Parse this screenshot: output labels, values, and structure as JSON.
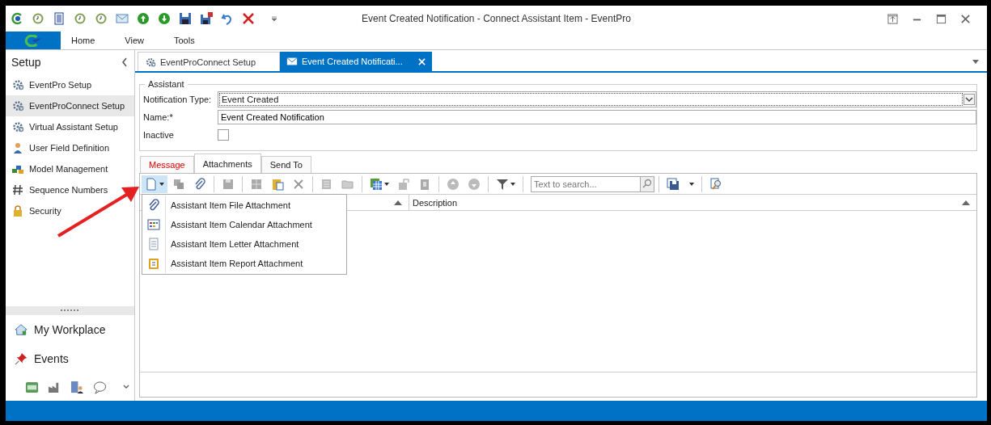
{
  "window": {
    "title": "Event Created Notification - Connect Assistant Item - EventPro"
  },
  "ribbon_tabs": [
    {
      "label": "Home"
    },
    {
      "label": "View"
    },
    {
      "label": "Tools"
    }
  ],
  "sidebar": {
    "title": "Setup",
    "items": [
      {
        "label": "EventPro Setup",
        "selected": false
      },
      {
        "label": "EventProConnect Setup",
        "selected": true
      },
      {
        "label": "Virtual Assistant Setup",
        "selected": false
      },
      {
        "label": "User Field Definition",
        "selected": false
      },
      {
        "label": "Model Management",
        "selected": false
      },
      {
        "label": "Sequence Numbers",
        "selected": false
      },
      {
        "label": "Security",
        "selected": false
      }
    ],
    "groups": [
      {
        "label": "My Workplace"
      },
      {
        "label": "Events"
      }
    ]
  },
  "doc_tabs": [
    {
      "label": "EventProConnect Setup",
      "selected": false
    },
    {
      "label": "Event Created Notificati...",
      "selected": true
    }
  ],
  "form": {
    "group": "Assistant",
    "notification_type": {
      "label": "Notification Type:",
      "value": "Event Created"
    },
    "name": {
      "label": "Name:*",
      "value": "Event Created Notification"
    },
    "inactive": {
      "label": "Inactive",
      "checked": false
    }
  },
  "sub_tabs": [
    {
      "label": "Message",
      "selected": false,
      "invalid": true
    },
    {
      "label": "Attachments",
      "selected": true,
      "invalid": false
    },
    {
      "label": "Send To",
      "selected": false,
      "invalid": false
    }
  ],
  "search": {
    "placeholder": "Text to search..."
  },
  "grid": {
    "columns": [
      "Description"
    ]
  },
  "new_menu": {
    "items": [
      {
        "label": "Assistant Item File Attachment"
      },
      {
        "label": "Assistant Item Calendar Attachment"
      },
      {
        "label": "Assistant Item Letter Attachment"
      },
      {
        "label": "Assistant Item Report Attachment"
      }
    ]
  }
}
